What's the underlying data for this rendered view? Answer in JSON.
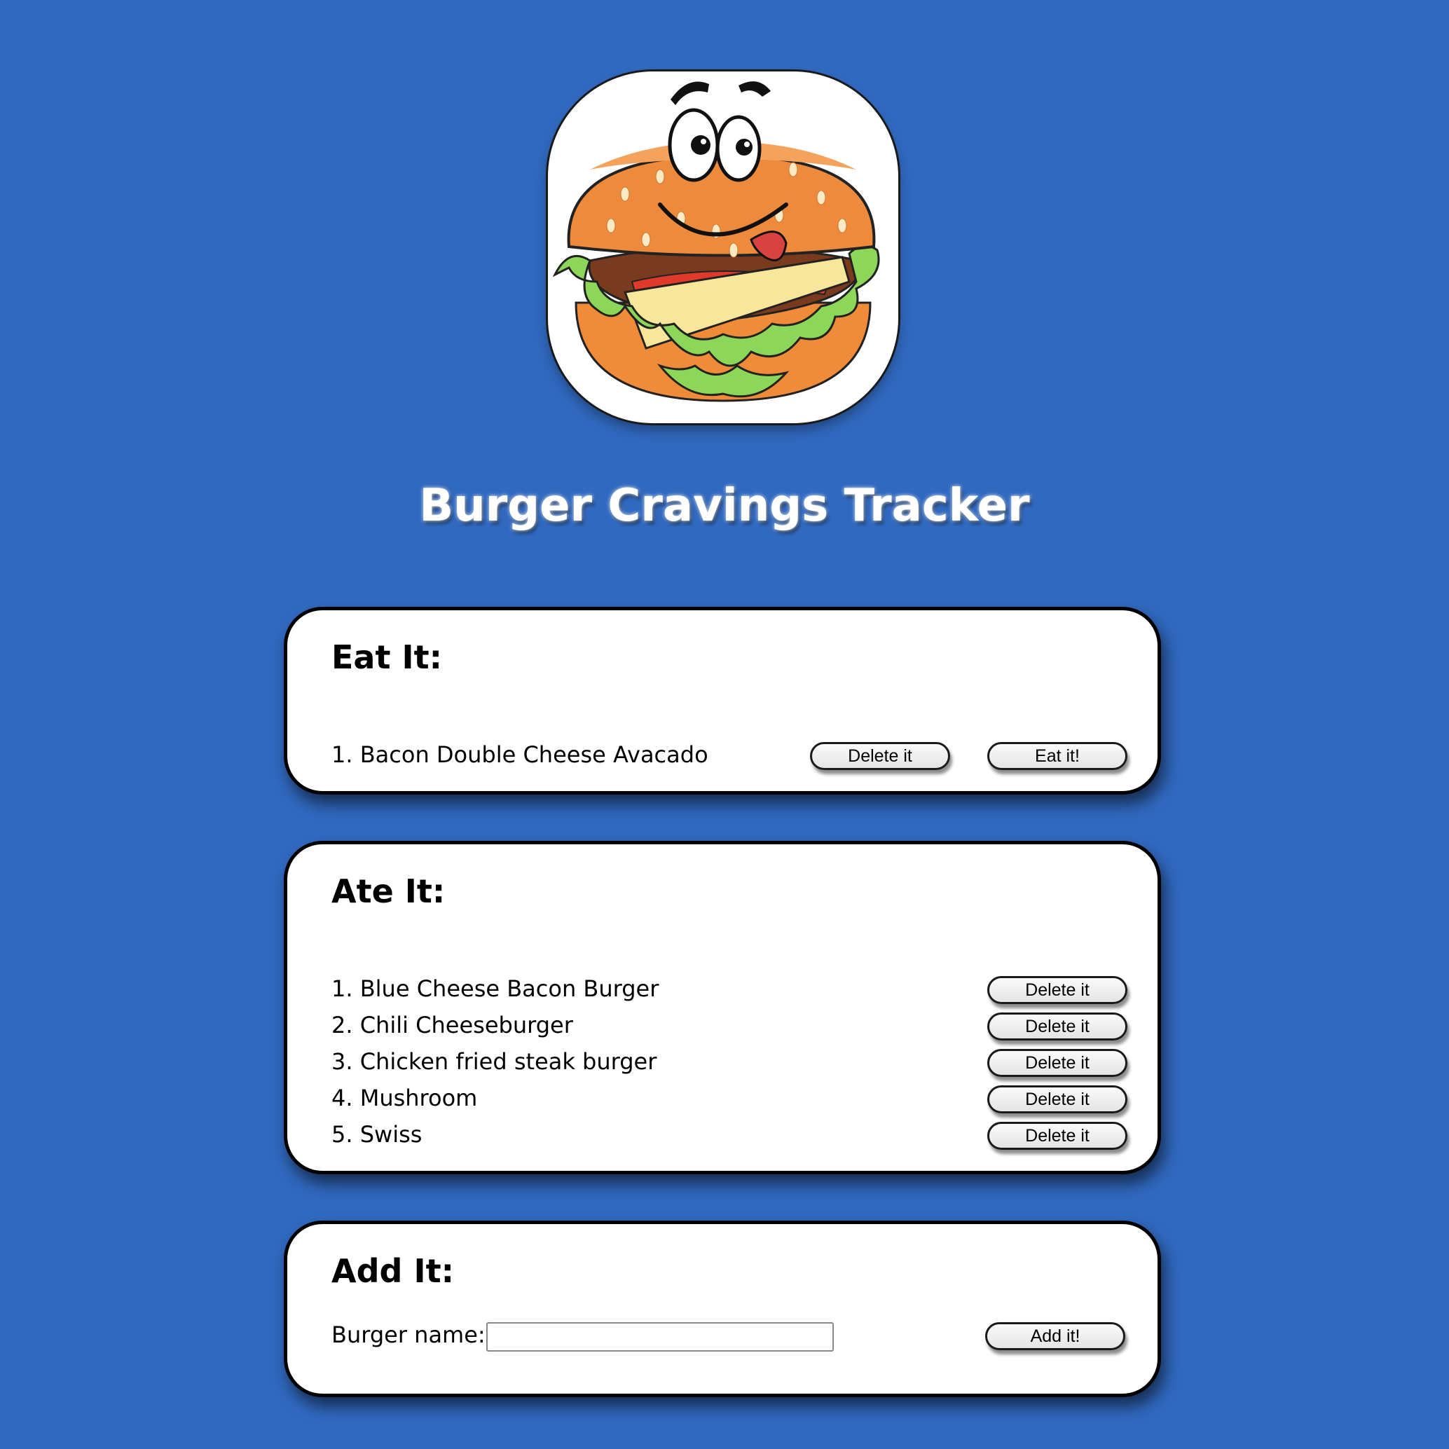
{
  "app": {
    "title": "Burger Cravings Tracker",
    "logo_icon": "cartoon-burger-logo"
  },
  "eat_section": {
    "heading": "Eat It:",
    "items": [
      {
        "label": "1. Bacon Double Cheese Avacado",
        "delete_label": "Delete it",
        "eat_label": "Eat it!"
      }
    ]
  },
  "ate_section": {
    "heading": "Ate It:",
    "items": [
      {
        "label": "1. Blue Cheese Bacon Burger",
        "delete_label": "Delete it"
      },
      {
        "label": "2. Chili Cheeseburger",
        "delete_label": "Delete it"
      },
      {
        "label": "3. Chicken fried steak burger",
        "delete_label": "Delete it"
      },
      {
        "label": "4. Mushroom",
        "delete_label": "Delete it"
      },
      {
        "label": "5. Swiss",
        "delete_label": "Delete it"
      }
    ]
  },
  "add_section": {
    "heading": "Add It:",
    "field_label": "Burger name:",
    "field_value": "",
    "field_placeholder": "",
    "submit_label": "Add it!"
  },
  "colors": {
    "background": "#3169bf",
    "card": "#ffffff",
    "button": "#ececec"
  }
}
